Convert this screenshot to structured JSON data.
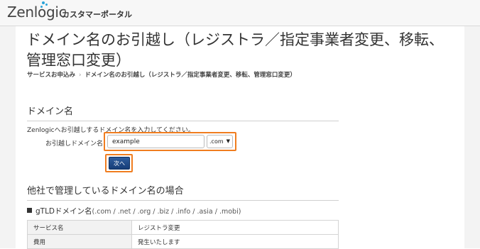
{
  "header": {
    "logo_text": "Zenlogic",
    "portal_title": "カスタマーポータル",
    "brand_color": "#2aa3d8"
  },
  "page": {
    "title": "ドメイン名のお引越し（レジストラ／指定事業者変更、移転、管理窓口変更）",
    "breadcrumb": [
      "サービスお申込み",
      "ドメイン名のお引越し（レジストラ／指定事業者変更、移転、管理窓口変更）"
    ]
  },
  "domain_section": {
    "heading": "ドメイン名",
    "instruction": "Zenlogicへお引越しするドメイン名を入力してください。",
    "field_label": "お引越しドメイン名",
    "input_value": "example",
    "tld_selected": ".com",
    "next_button": "次へ",
    "highlight_color": "#f07d1f"
  },
  "other_section": {
    "heading": "他社で管理しているドメイン名の場合",
    "gtld_title": "gTLDドメイン名",
    "gtld_list": "(.com / .net / .org / .biz / .info / .asia / .mobi)",
    "table": [
      {
        "key": "サービス名",
        "value": "レジストラ変更"
      },
      {
        "key": "費用",
        "value": "発生いたします"
      }
    ]
  }
}
